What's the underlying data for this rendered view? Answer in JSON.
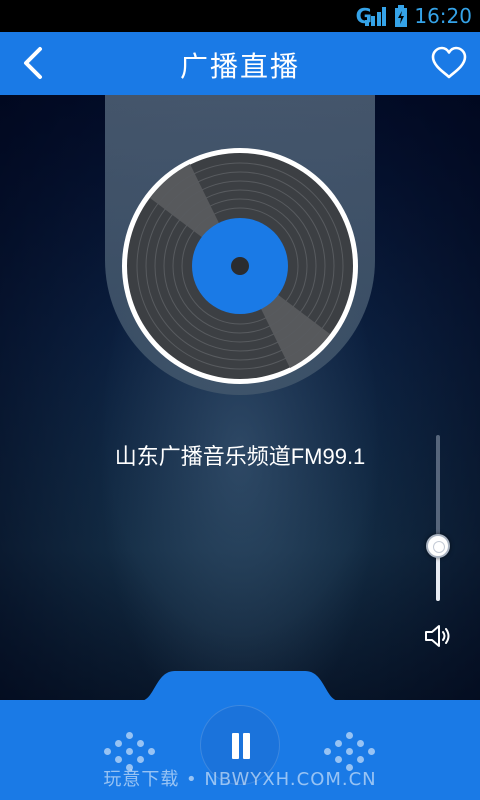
{
  "status_bar": {
    "network_type": "G",
    "time": "16:20",
    "icons": [
      "signal-icon",
      "battery-charging-icon"
    ],
    "accent_color": "#35a3e8"
  },
  "header": {
    "title": "广播直播",
    "back_icon": "chevron-left-icon",
    "favorite_icon": "heart-outline-icon",
    "background_color": "#1a7ae6"
  },
  "player": {
    "station_name": "山东广播音乐频道FM99.1",
    "disc_label_color": "#1a7ae6",
    "volume_level": 0.33,
    "volume_icon": "speaker-icon"
  },
  "controls": {
    "play_state_icon": "pause-icon",
    "left_decor_icon": "dots-pattern-icon",
    "right_decor_icon": "dots-pattern-icon"
  },
  "watermark": "玩意下载 • NBWYXH.COM.CN"
}
